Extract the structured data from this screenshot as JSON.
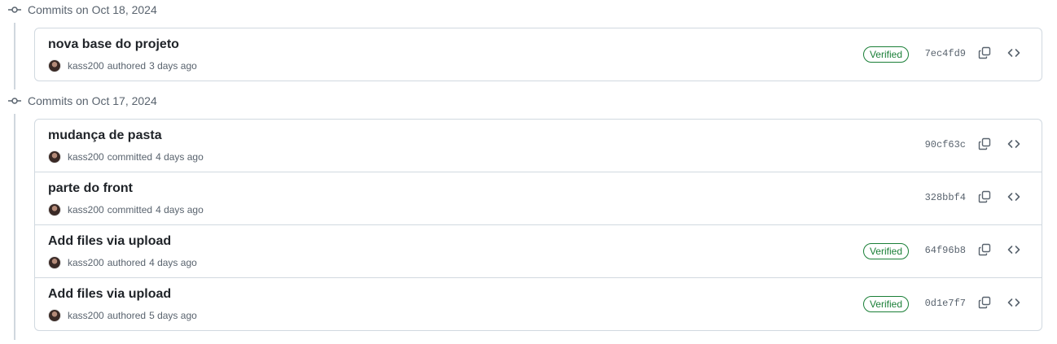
{
  "groups": [
    {
      "title": "Commits on Oct 18, 2024",
      "commits": [
        {
          "message": "nova base do projeto",
          "author": "kass200",
          "action": "authored",
          "time": "3 days ago",
          "verified": "Verified",
          "sha": "7ec4fd9"
        }
      ]
    },
    {
      "title": "Commits on Oct 17, 2024",
      "commits": [
        {
          "message": "mudança de pasta",
          "author": "kass200",
          "action": "committed",
          "time": "4 days ago",
          "verified": "",
          "sha": "90cf63c"
        },
        {
          "message": "parte do front",
          "author": "kass200",
          "action": "committed",
          "time": "4 days ago",
          "verified": "",
          "sha": "328bbf4"
        },
        {
          "message": "Add files via upload",
          "author": "kass200",
          "action": "authored",
          "time": "4 days ago",
          "verified": "Verified",
          "sha": "64f96b8"
        },
        {
          "message": "Add files via upload",
          "author": "kass200",
          "action": "authored",
          "time": "5 days ago",
          "verified": "Verified",
          "sha": "0d1e7f7"
        }
      ]
    }
  ],
  "icons": {
    "timeline": "git-commit-icon",
    "avatar": "avatar",
    "copy": "copy-icon",
    "browse": "code-icon"
  },
  "colors": {
    "verified": "#1a7f37",
    "border": "#d1d9e0",
    "muted": "#59636e",
    "text": "#1f2328"
  }
}
